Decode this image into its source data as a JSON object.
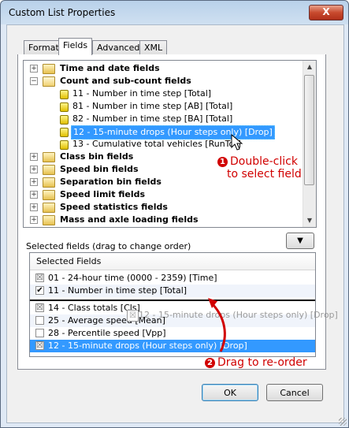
{
  "window": {
    "title": "Custom List Properties",
    "close_glyph": "X"
  },
  "tabs": [
    "Format",
    "Fields",
    "Advanced",
    "XML"
  ],
  "tree": {
    "categories_top": [
      {
        "label": "Time and date fields",
        "expander": "+"
      },
      {
        "label": "Count and sub-count fields",
        "expander": "−"
      }
    ],
    "children": [
      "11 - Number in time step [Total]",
      "81 - Number in time step [AB] [Total]",
      "82 - Number in time step [BA] [Total]",
      "12 - 15-minute drops (Hour steps only) [Drop]",
      "13 - Cumulative total vehicles [RunTot]"
    ],
    "categories_bottom": [
      "Class bin fields",
      "Speed bin fields",
      "Separation bin fields",
      "Speed limit fields",
      "Speed statistics fields",
      "Mass and axle loading fields"
    ]
  },
  "selected_label": "Selected fields (drag to change order)",
  "dropdown_glyph": "▼",
  "list": {
    "header": "Selected Fields",
    "rows": [
      {
        "text": "01 - 24-hour time (0000 - 2359) [Time]",
        "check": "☒"
      },
      {
        "text": "11 - Number in time step [Total]",
        "check": "✔"
      },
      {
        "text": "14 - Class totals [Cls]",
        "check": "☒"
      },
      {
        "text": "25 - Average speed [Mean]",
        "check": ""
      },
      {
        "text": "28 - Percentile speed [Vpp]",
        "check": ""
      },
      {
        "text": "12 - 15-minute drops (Hour steps only) [Drop]",
        "check": "☒"
      }
    ],
    "ghost": "12 - 15-minute drops (Hour steps only) [Drop]"
  },
  "annotations": {
    "one_badge": "1",
    "one_line1": "Double-click",
    "one_line2": "to select field",
    "two_badge": "2",
    "two_text": "Drag to re-order"
  },
  "buttons": {
    "ok": "OK",
    "cancel": "Cancel"
  },
  "colors": {
    "selection": "#3399ff",
    "annotation": "#d10000"
  }
}
